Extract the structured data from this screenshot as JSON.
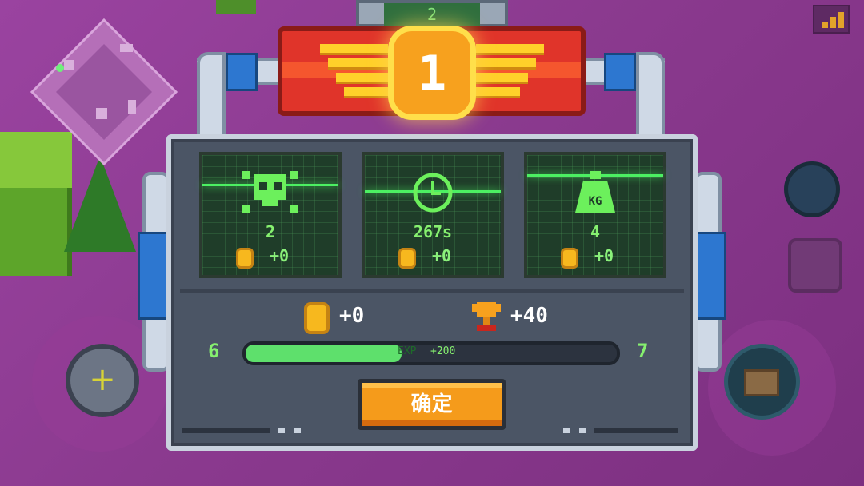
{
  "top_counter": {
    "value": "2"
  },
  "medal": {
    "rank": "1"
  },
  "stats": [
    {
      "name": "kills",
      "icon": "skull-icon",
      "value": "2",
      "coins": "+0"
    },
    {
      "name": "time",
      "icon": "clock-icon",
      "value": "267s",
      "coins": "+0"
    },
    {
      "name": "weight",
      "icon": "kg-weight-icon",
      "icon_text": "KG",
      "value": "4",
      "coins": "+0"
    }
  ],
  "rewards": {
    "coins": "+0",
    "trophies": "+40"
  },
  "level": {
    "current": "6",
    "next": "7",
    "exp_label": "EXP",
    "exp_gain": "+200",
    "progress_fraction": 0.42
  },
  "confirm_label": "确定",
  "colors": {
    "background": "#8b3a8f",
    "banner": "#e0342a",
    "screen_green": "#86f06f",
    "button": "#f59b1b"
  }
}
